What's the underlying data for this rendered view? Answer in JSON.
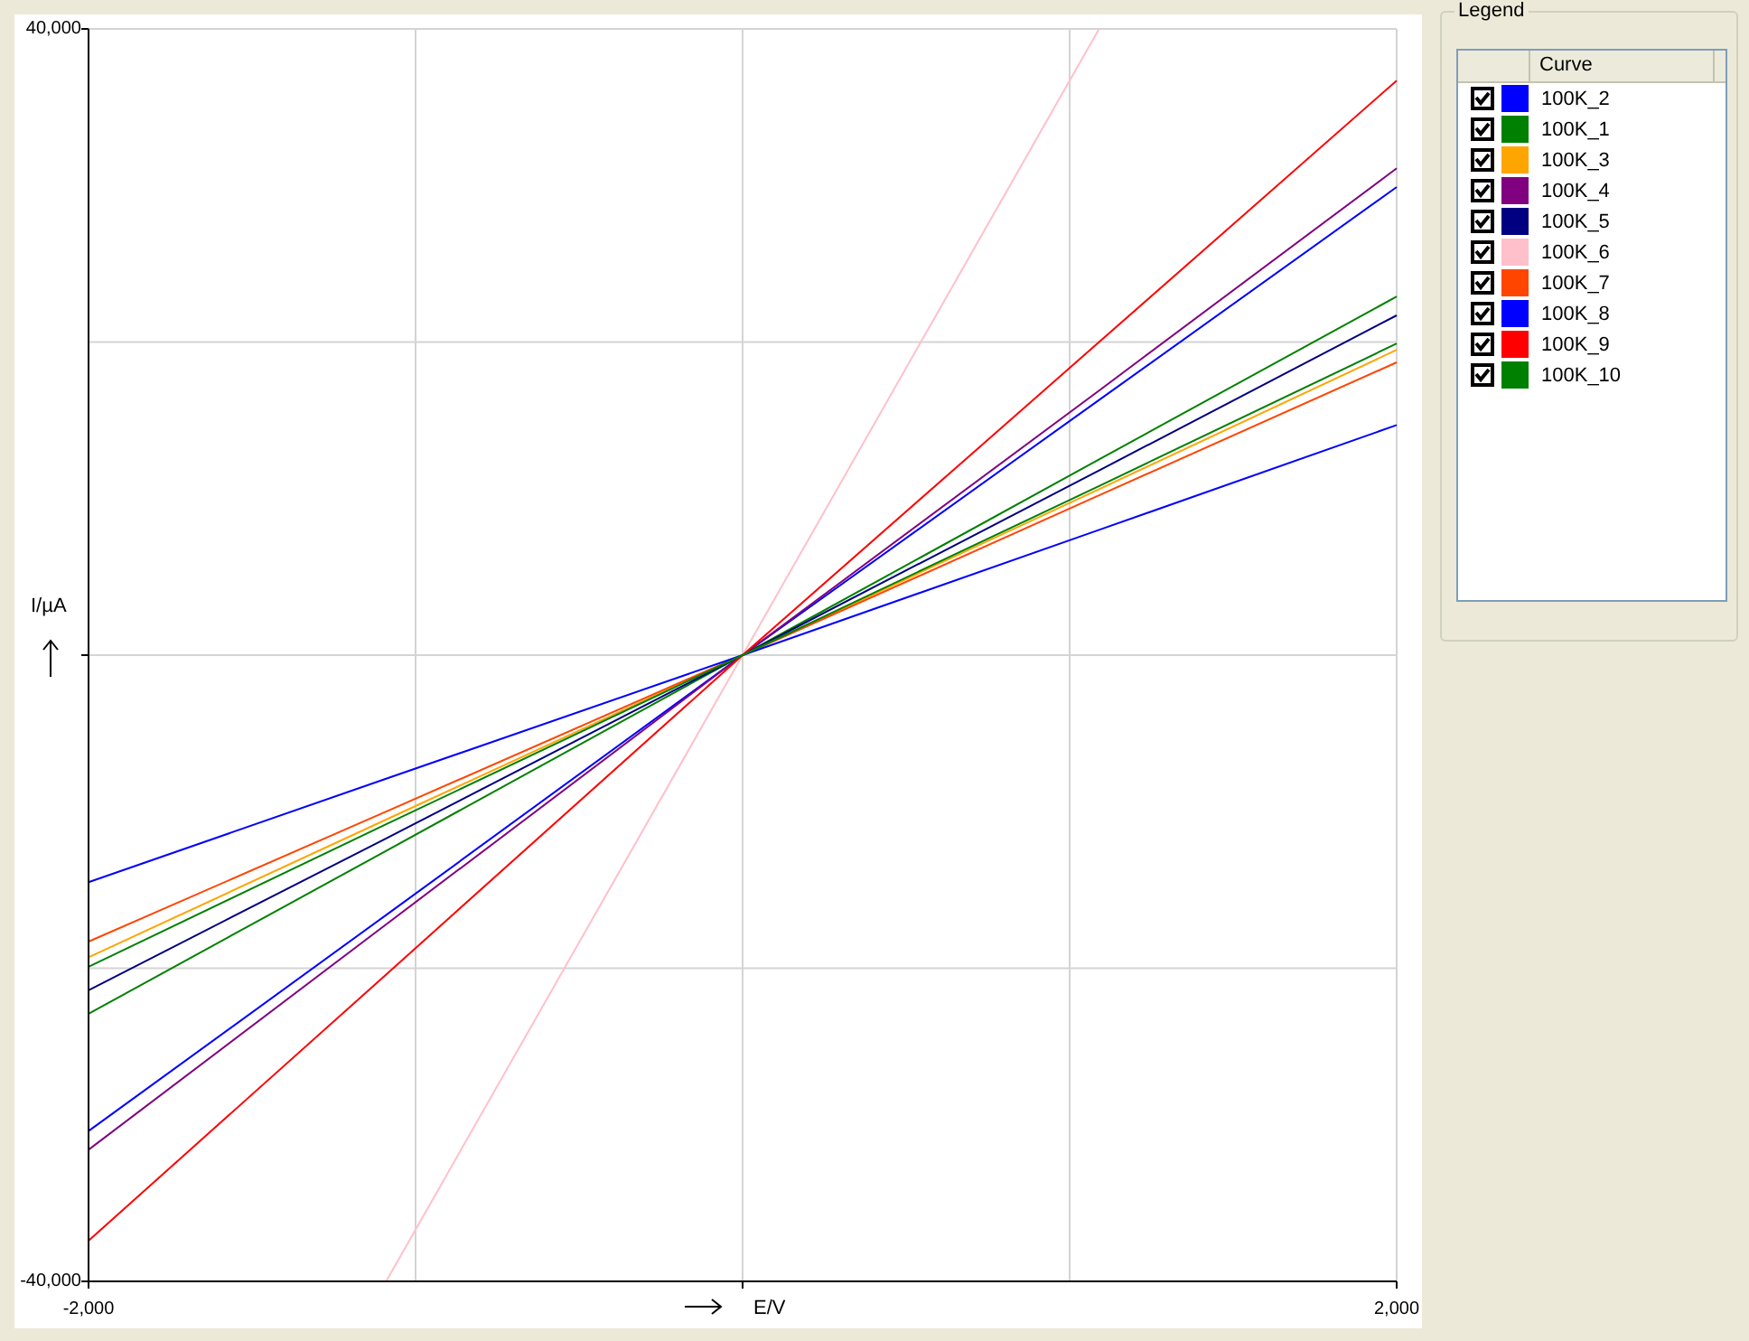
{
  "chart": {
    "chart_data": {
      "type": "line",
      "xlabel": "E/V",
      "ylabel": "I/µA",
      "x": [
        -2000,
        -1090,
        0,
        1090,
        2000
      ],
      "xlim": [
        -2000,
        2000
      ],
      "ylim": [
        -40000,
        40000
      ],
      "xticks": [
        {
          "value": -2000,
          "label": "-2,000"
        },
        {
          "value": 2000,
          "label": "2,000"
        }
      ],
      "yticks": [
        {
          "value": -40000,
          "label": "-40,000"
        },
        {
          "value": 40000,
          "label": "40,000"
        }
      ],
      "series": [
        {
          "name": "100K_2",
          "color": "#0000ff",
          "values": [
            -30400,
            -16600,
            0,
            16300,
            29900
          ]
        },
        {
          "name": "100K_1",
          "color": "#008000",
          "values": [
            -22900,
            -12500,
            0,
            12500,
            22900
          ]
        },
        {
          "name": "100K_3",
          "color": "#ffa500",
          "values": [
            -19300,
            -10500,
            0,
            10600,
            19500
          ]
        },
        {
          "name": "100K_4",
          "color": "#800080",
          "values": [
            -31600,
            -17200,
            0,
            16900,
            31100
          ]
        },
        {
          "name": "100K_5",
          "color": "#000080",
          "values": [
            -21400,
            -11700,
            0,
            11800,
            21700
          ]
        },
        {
          "name": "100K_6",
          "color": "#ffc0cb",
          "values": [
            null,
            -40000,
            0,
            40000,
            null
          ]
        },
        {
          "name": "100K_7",
          "color": "#ff4500",
          "values": [
            -18300,
            -10000,
            0,
            10200,
            18700
          ]
        },
        {
          "name": "100K_8",
          "color": "#0000ff",
          "values": [
            -14500,
            -7900,
            0,
            8000,
            14700
          ]
        },
        {
          "name": "100K_9",
          "color": "#ff0000",
          "values": [
            -37400,
            -20400,
            0,
            20000,
            36700
          ]
        },
        {
          "name": "100K_10",
          "color": "#008000",
          "values": [
            -19900,
            -10800,
            0,
            10800,
            19900
          ]
        }
      ]
    }
  },
  "legend": {
    "title": "Legend",
    "column": "Curve",
    "items": [
      {
        "checked": true
      },
      {
        "checked": true
      },
      {
        "checked": true
      },
      {
        "checked": true
      },
      {
        "checked": true
      },
      {
        "checked": true
      },
      {
        "checked": true
      },
      {
        "checked": true
      },
      {
        "checked": true
      },
      {
        "checked": true
      }
    ]
  }
}
